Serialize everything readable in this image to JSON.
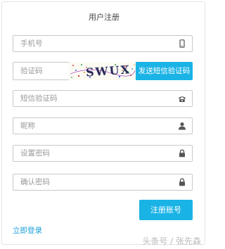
{
  "form": {
    "title": "用户注册",
    "phone_placeholder": "手机号",
    "captcha_placeholder": "验证码",
    "captcha_text": "SWUX",
    "send_sms_label": "发送短信验证码",
    "sms_code_placeholder": "短信验证码",
    "nickname_placeholder": "昵称",
    "password_placeholder": "设置密码",
    "confirm_password_placeholder": "确认密码",
    "register_label": "注册账号",
    "login_link": "立即登录"
  },
  "icons": {
    "phone": "mobile-phone-icon",
    "sms": "telephone-icon",
    "nickname": "user-icon",
    "password": "lock-icon",
    "confirm": "lock-icon"
  },
  "watermark": "头条号 / 张先森",
  "colors": {
    "accent": "#1ab3e6",
    "link": "#1a9fd9",
    "border": "#c9c9c9",
    "placeholder": "#999999"
  }
}
